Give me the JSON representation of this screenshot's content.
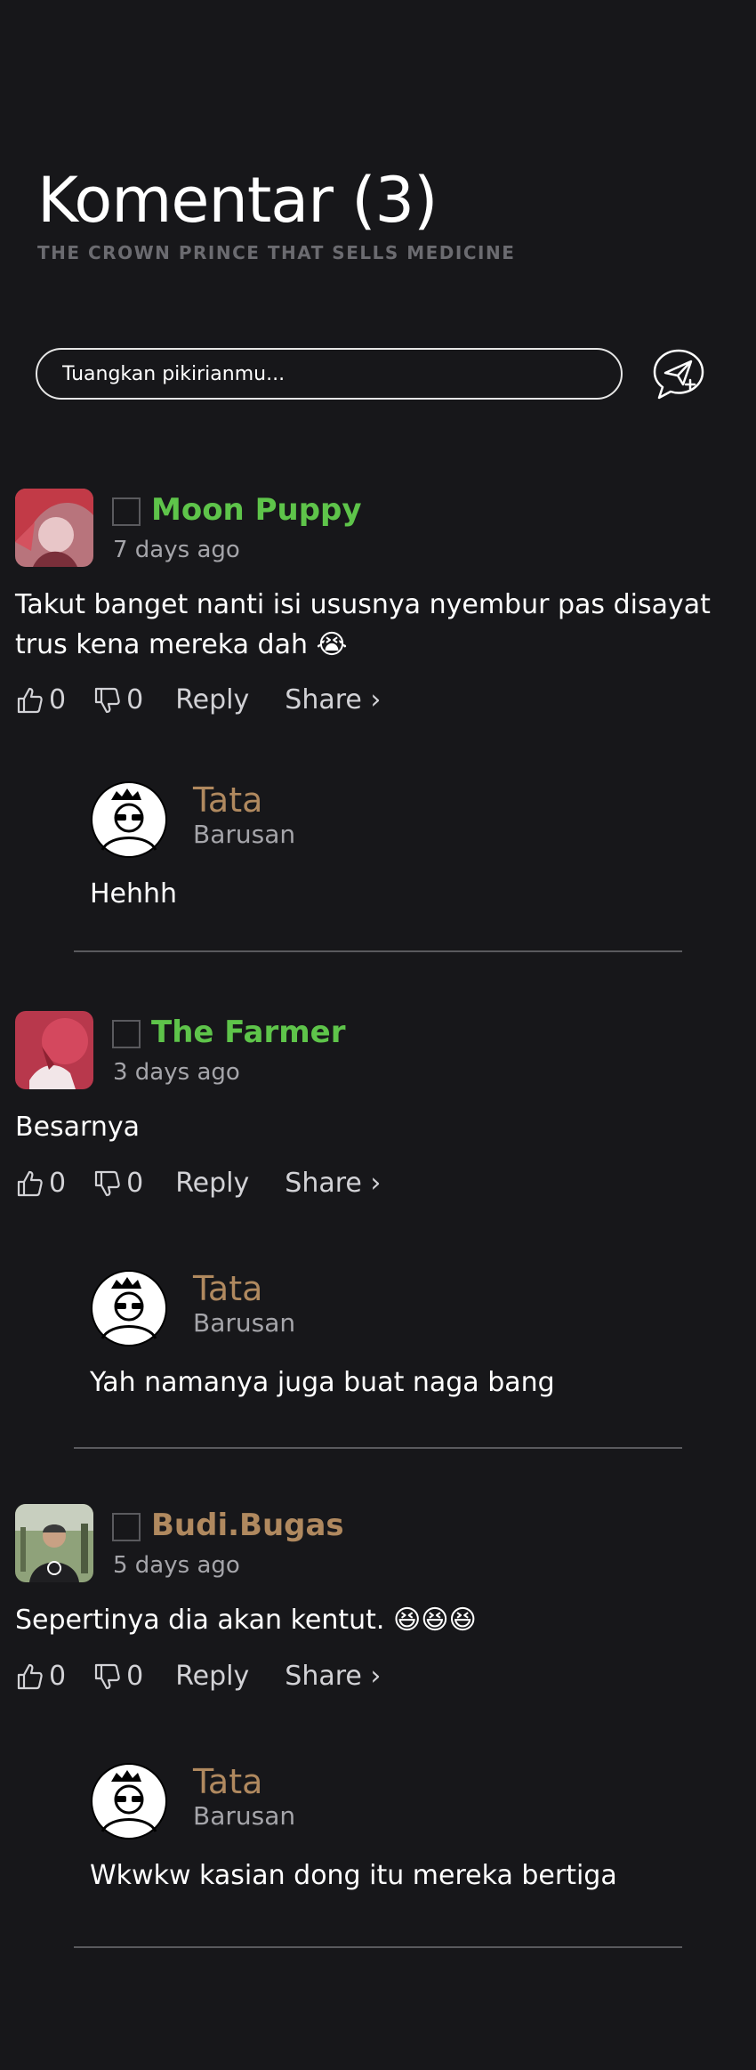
{
  "header": {
    "title": "Komentar (3)",
    "subtitle": "THE CROWN PRINCE THAT SELLS MEDICINE"
  },
  "composer": {
    "placeholder": "Tuangkan pikirianmu...",
    "send_icon": "send-plus-icon"
  },
  "colors": {
    "background": "#17171a",
    "green_user": "#5ec44a",
    "gold_user": "#b0895f",
    "muted": "#a5a5aa"
  },
  "comments": [
    {
      "name": "Moon Puppy",
      "time": "7 days ago",
      "text": "Takut banget nanti isi ususnya nyembur pas disayat trus kena mereka dah 😭",
      "likes": "0",
      "dislikes": "0",
      "reply_label": "Reply",
      "share_label": "Share ›",
      "reply": {
        "name": "Tata",
        "time": "Barusan",
        "text": "Hehhh"
      }
    },
    {
      "name": "The Farmer",
      "time": "3 days ago",
      "text": "Besarnya",
      "likes": "0",
      "dislikes": "0",
      "reply_label": "Reply",
      "share_label": "Share ›",
      "reply": {
        "name": "Tata",
        "time": "Barusan",
        "text": "Yah namanya juga buat naga bang"
      }
    },
    {
      "name": "Budi.Bugas",
      "time": "5 days ago",
      "text": "Sepertinya dia akan kentut. 😆😆😆",
      "likes": "0",
      "dislikes": "0",
      "reply_label": "Reply",
      "share_label": "Share ›",
      "reply": {
        "name": "Tata",
        "time": "Barusan",
        "text": "Wkwkw kasian dong itu mereka bertiga"
      }
    }
  ]
}
